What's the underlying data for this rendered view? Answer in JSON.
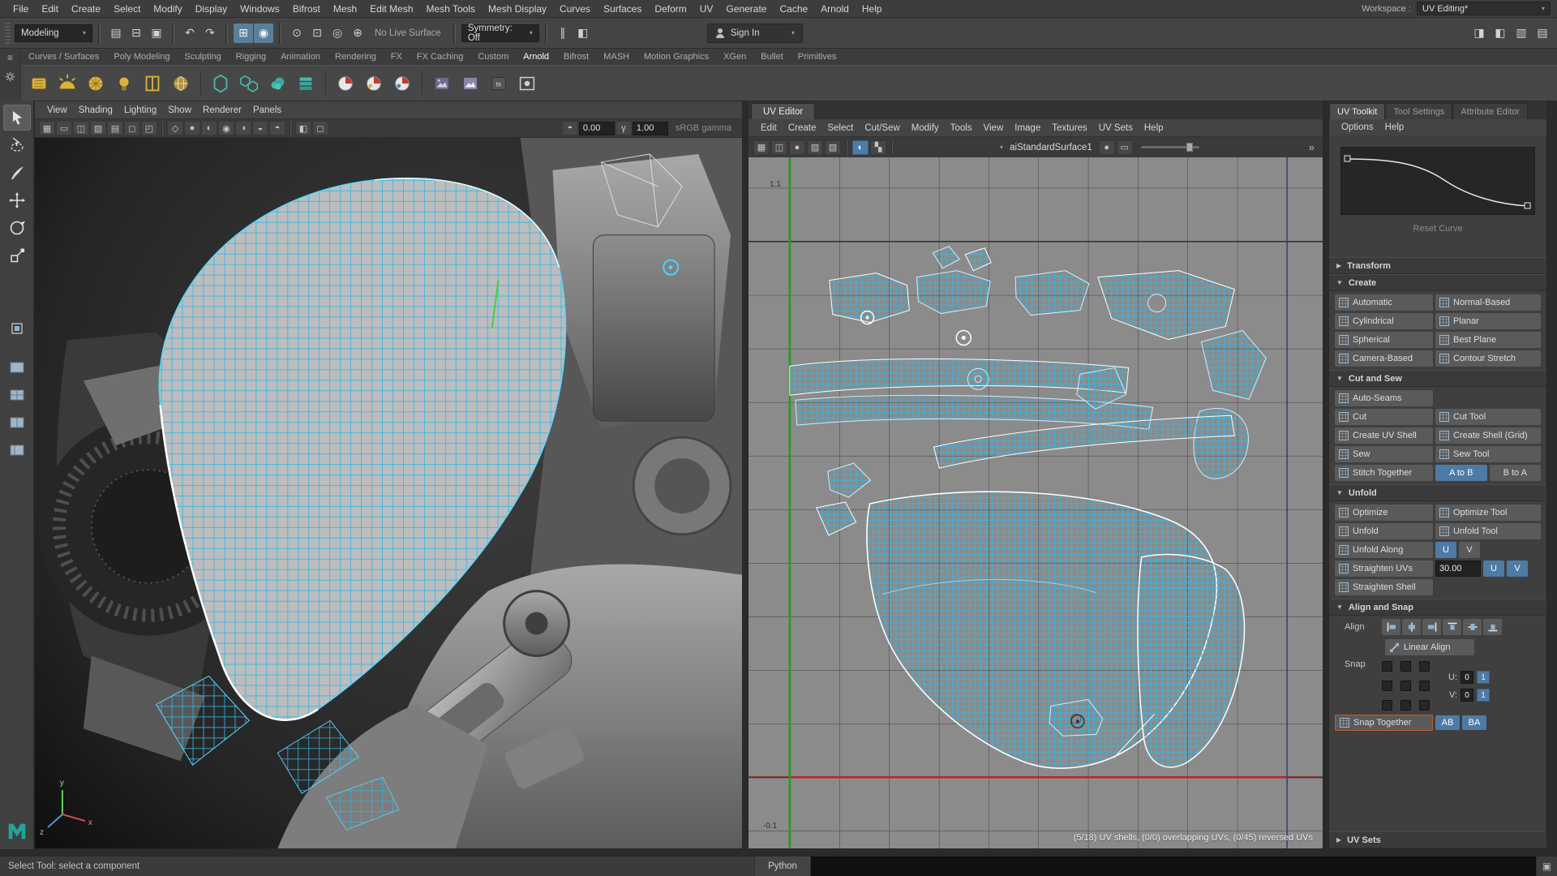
{
  "app": {
    "workspace_label": "Workspace :",
    "workspace_value": "UV Editing*"
  },
  "menu_bar": {
    "items": [
      "File",
      "Edit",
      "Create",
      "Select",
      "Modify",
      "Display",
      "Windows",
      "Bifrost",
      "Mesh",
      "Edit Mesh",
      "Mesh Tools",
      "Mesh Display",
      "Curves",
      "Surfaces",
      "Deform",
      "UV",
      "Generate",
      "Cache",
      "Arnold",
      "Help"
    ]
  },
  "status_line": {
    "mode_selector": "Modeling",
    "live_surface": "No Live Surface",
    "symmetry": "Symmetry: Off",
    "sign_in": "Sign In"
  },
  "shelf": {
    "tabs": [
      "Curves / Surfaces",
      "Poly Modeling",
      "Sculpting",
      "Rigging",
      "Animation",
      "Rendering",
      "FX",
      "FX Caching",
      "Custom",
      "Arnold",
      "Bifrost",
      "MASH",
      "Motion Graphics",
      "XGen",
      "Bullet",
      "Primitives"
    ],
    "active_tab": "Arnold"
  },
  "viewport": {
    "menus": [
      "View",
      "Shading",
      "Lighting",
      "Show",
      "Renderer",
      "Panels"
    ],
    "exposure_value": "0.00",
    "gamma_value": "1.00",
    "colorspace": "sRGB gamma"
  },
  "uv_editor": {
    "title": "UV Editor",
    "menus": [
      "Edit",
      "Create",
      "Select",
      "Cut/Sew",
      "Modify",
      "Tools",
      "View",
      "Image",
      "Textures",
      "UV Sets",
      "Help"
    ],
    "material": "aiStandardSurface1",
    "grid_label_top": "1.1",
    "grid_label_bottom": "-0.1",
    "status": "(5/18) UV shells, (0/0) overlapping UVs, (0/45) reversed UVs"
  },
  "uv_toolkit": {
    "tabs": [
      "UV Toolkit",
      "Tool Settings",
      "Attribute Editor"
    ],
    "menus": [
      "Options",
      "Help"
    ],
    "reset_curve_label": "Reset Curve",
    "sections": {
      "transform": "Transform",
      "create": "Create",
      "cut_sew": "Cut and Sew",
      "unfold": "Unfold",
      "align_snap": "Align and Snap",
      "uv_sets": "UV Sets"
    },
    "create_buttons": [
      "Automatic",
      "Normal-Based",
      "Cylindrical",
      "Planar",
      "Spherical",
      "Best Plane",
      "Camera-Based",
      "Contour Stretch"
    ],
    "cut_sew": {
      "auto_seams": "Auto-Seams",
      "cut": "Cut",
      "cut_tool": "Cut Tool",
      "create_uv_shell": "Create UV Shell",
      "create_shell_grid": "Create Shell (Grid)",
      "sew": "Sew",
      "sew_tool": "Sew Tool",
      "stitch_together": "Stitch Together",
      "a_to_b": "A to B",
      "b_to_a": "B to A"
    },
    "unfold": {
      "optimize": "Optimize",
      "optimize_tool": "Optimize Tool",
      "unfold": "Unfold",
      "unfold_tool": "Unfold Tool",
      "unfold_along": "Unfold Along",
      "u": "U",
      "v": "V",
      "straighten_uvs": "Straighten UVs",
      "straighten_angle": "30.00",
      "straighten_shell": "Straighten Shell"
    },
    "align_snap": {
      "align_label": "Align",
      "linear_align": "Linear Align",
      "snap_label": "Snap",
      "u_label": "U:",
      "v_label": "V:",
      "u_min": "0",
      "u_max": "1",
      "v_min": "0",
      "v_max": "1",
      "snap_together": "Snap Together",
      "ab": "AB",
      "ba": "BA"
    }
  },
  "command_line": {
    "language": "Python",
    "help_text": "Select Tool: select a component"
  },
  "icons": {
    "caret": "▾",
    "section_open": "▼",
    "section_closed": "▶",
    "menu_handle": "≡",
    "new_scene": "▤",
    "open_scene": "⊟",
    "save_scene": "▣",
    "undo": "↶",
    "redo": "↷",
    "snap_grid": "⊞",
    "snap_point": "◉",
    "snap_curve": "⊙",
    "snap_plane": "⊡",
    "snap_mesh": "◎",
    "make_live": "⊕",
    "pause": "∥",
    "xray": "◧",
    "panel_attr": "◨",
    "panel_tool": "◧",
    "panel_channel": "▥",
    "panel_outliner": "▤",
    "grid": "▦",
    "film_gate": "▭",
    "res_gate": "◫",
    "gate_mask": "▧",
    "field_chart": "▤",
    "safe_action": "◻",
    "safe_title": "◰",
    "wireframe": "◇",
    "shaded": "●",
    "textured": "◐",
    "lighting": "◉",
    "shadows": "◑",
    "ao": "◒",
    "motion_blur": "◓",
    "exposure": "◓",
    "gamma": "γ",
    "double_chevron": "»",
    "checker": "▚",
    "image": "▨",
    "sphere": "●"
  },
  "colors": {
    "accent_blue": "#4d7ba5",
    "wireframe_cyan": "#35c8ff",
    "selection_white": "#ffffff",
    "axis_green": "#1f9e1f",
    "axis_red": "#c22222"
  }
}
